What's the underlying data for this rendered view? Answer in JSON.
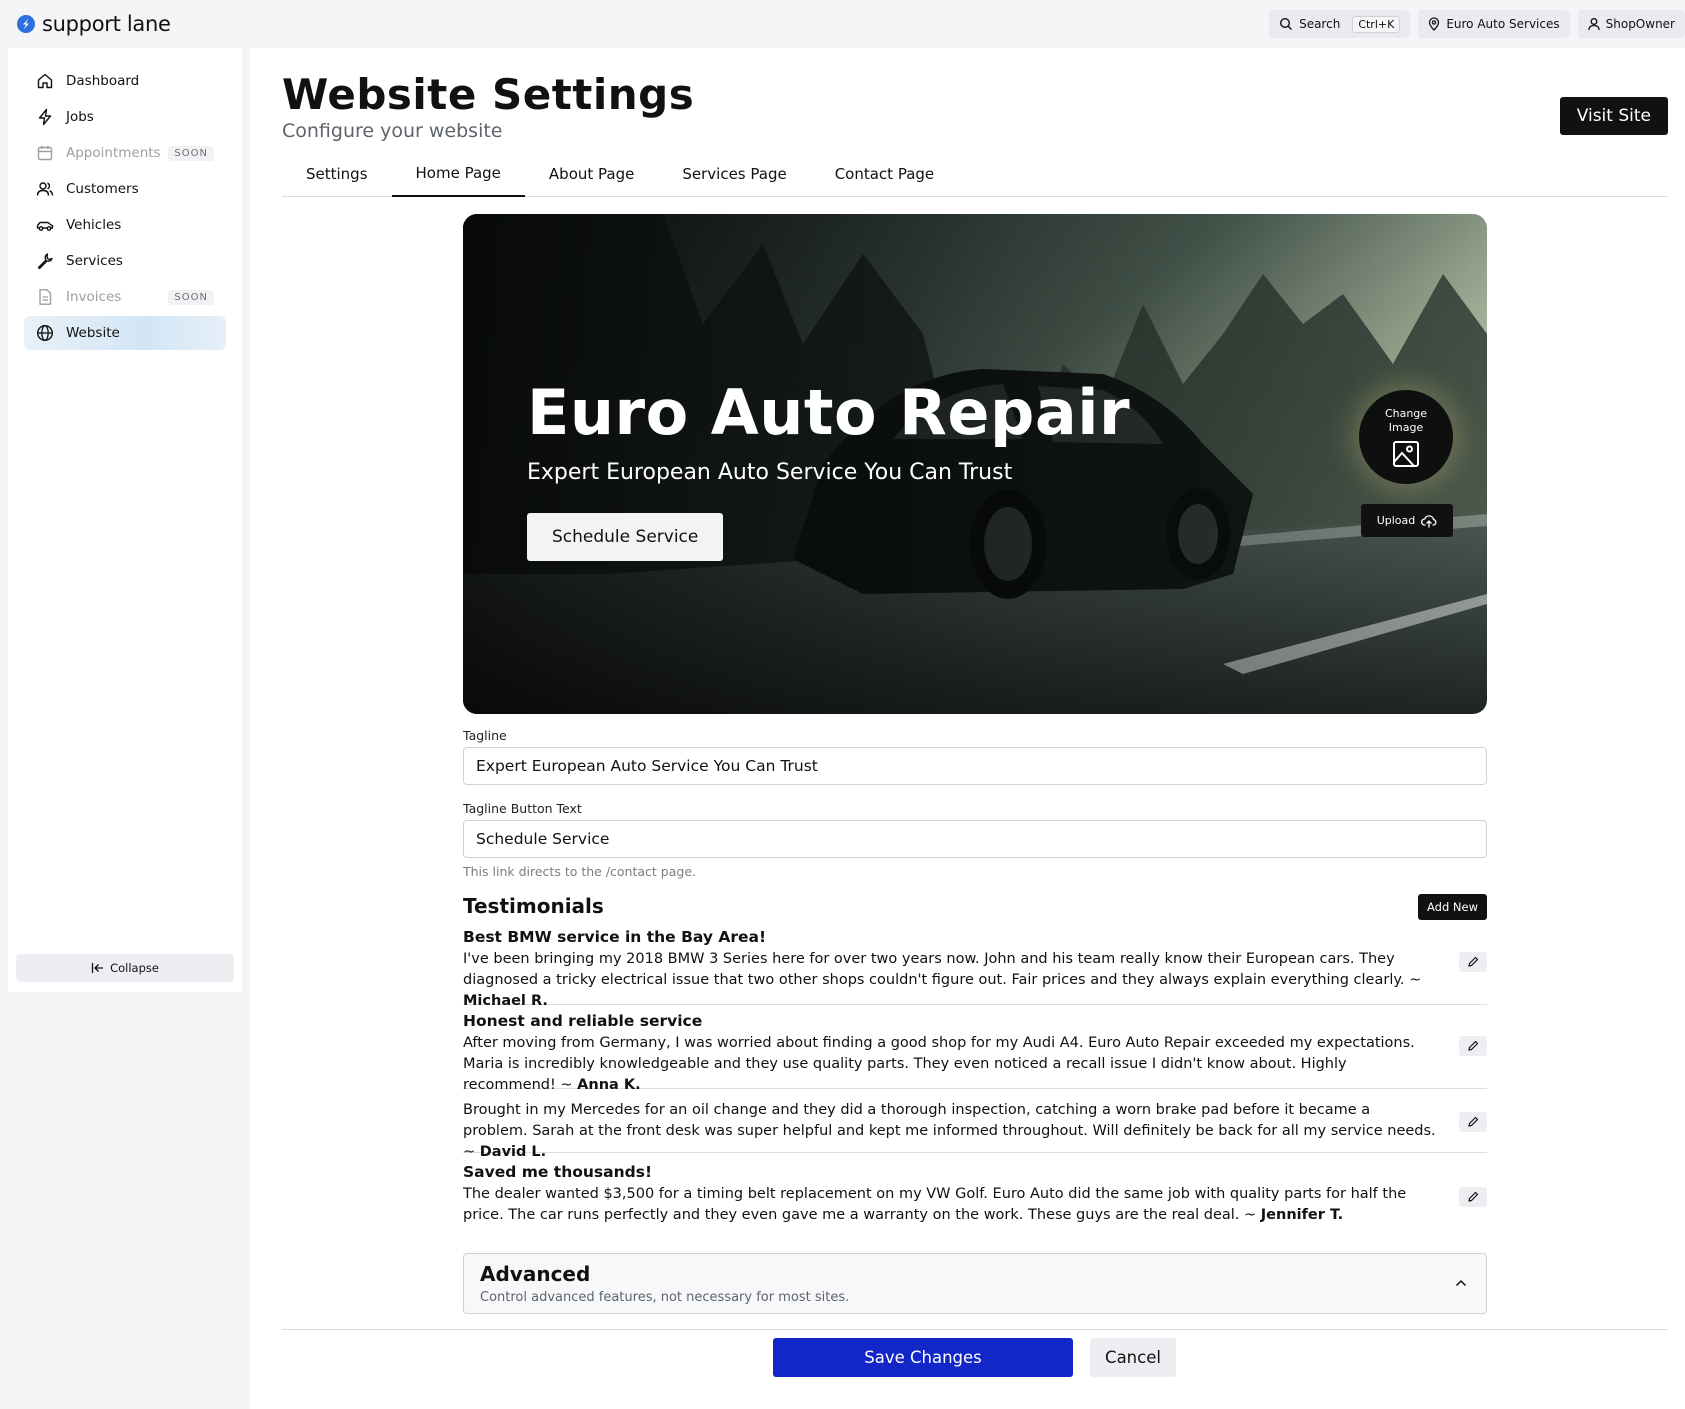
{
  "app": {
    "name": "support lane"
  },
  "topbar": {
    "search_label": "Search",
    "search_shortcut": "Ctrl+K",
    "location_label": "Euro Auto Services",
    "user_label": "ShopOwner"
  },
  "sidebar": {
    "items": [
      {
        "label": "Dashboard",
        "icon": "home-icon"
      },
      {
        "label": "Jobs",
        "icon": "bolt-icon"
      },
      {
        "label": "Appointments",
        "icon": "calendar-icon",
        "badge": "SOON",
        "disabled": true
      },
      {
        "label": "Customers",
        "icon": "users-icon"
      },
      {
        "label": "Vehicles",
        "icon": "car-icon"
      },
      {
        "label": "Services",
        "icon": "wrench-icon"
      },
      {
        "label": "Invoices",
        "icon": "document-icon",
        "badge": "SOON",
        "disabled": true
      },
      {
        "label": "Website",
        "icon": "globe-icon",
        "active": true
      }
    ],
    "collapse_label": "Collapse"
  },
  "page": {
    "title": "Website Settings",
    "subtitle": "Configure your website",
    "visit_label": "Visit Site"
  },
  "tabs": [
    {
      "label": "Settings"
    },
    {
      "label": "Home Page",
      "active": true
    },
    {
      "label": "About Page"
    },
    {
      "label": "Services Page"
    },
    {
      "label": "Contact Page"
    }
  ],
  "hero": {
    "title": "Euro Auto Repair",
    "subtitle": "Expert European Auto Service You Can Trust",
    "button_label": "Schedule Service",
    "change_image_label": "Change Image",
    "upload_label": "Upload"
  },
  "form": {
    "tagline_label": "Tagline",
    "tagline_value": "Expert European Auto Service You Can Trust",
    "button_text_label": "Tagline Button Text",
    "button_text_value": "Schedule Service",
    "button_hint": "This link directs to the /contact page."
  },
  "testimonials": {
    "title": "Testimonials",
    "add_label": "Add New",
    "items": [
      {
        "title": "Best BMW service in the Bay Area!",
        "body": "I've been bringing my 2018 BMW 3 Series here for over two years now. John and his team really know their European cars. They diagnosed a tricky electrical issue that two other shops couldn't figure out. Fair prices and they always explain everything clearly. ~ ",
        "author": "Michael R."
      },
      {
        "title": "Honest and reliable service",
        "body": "After moving from Germany, I was worried about finding a good shop for my Audi A4. Euro Auto Repair exceeded my expectations. Maria is incredibly knowledgeable and they use quality parts. They even noticed a recall issue I didn't know about. Highly recommend! ~ ",
        "author": "Anna K."
      },
      {
        "title": "",
        "body": "Brought in my Mercedes for an oil change and they did a thorough inspection, catching a worn brake pad before it became a problem. Sarah at the front desk was super helpful and kept me informed throughout. Will definitely be back for all my service needs. ~ ",
        "author": "David L."
      },
      {
        "title": "Saved me thousands!",
        "body": "The dealer wanted $3,500 for a timing belt replacement on my VW Golf. Euro Auto did the same job with quality parts for half the price. The car runs perfectly and they even gave me a warranty on the work. These guys are the real deal. ~ ",
        "author": "Jennifer T."
      }
    ]
  },
  "advanced": {
    "title": "Advanced",
    "subtitle": "Control advanced features, not necessary for most sites."
  },
  "footer": {
    "save_label": "Save Changes",
    "cancel_label": "Cancel"
  },
  "colors": {
    "primary": "#1326c8",
    "dark": "#111111",
    "active_nav": "#d3e6f5",
    "logo": "#2f6fe0"
  }
}
